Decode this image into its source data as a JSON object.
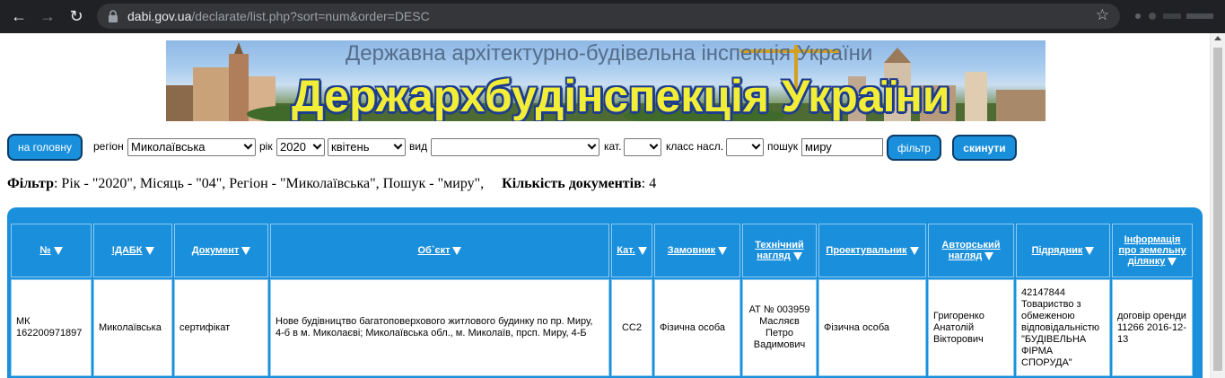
{
  "browser": {
    "url_host": "dabi.gov.ua",
    "url_path": "/declarate/list.php?sort=num&order=DESC"
  },
  "banner": {
    "subtitle": "Державна архітектурно-будівельна інспекція України",
    "title": "Держархбудінспекція України"
  },
  "filters": {
    "home_button": "на головну",
    "region_label": "регіон",
    "region_value": "Миколаївська",
    "year_label": "рік",
    "year_value": "2020",
    "month_value": "квітень",
    "type_label": "вид",
    "type_value": "",
    "cat_label": "кат.",
    "cat_value": "",
    "class_label": "класс насл.",
    "class_value": "",
    "search_label": "пошук",
    "search_value": "миру",
    "filter_button": "фільтр",
    "reset_button": "скинути"
  },
  "summary": {
    "filter_label": "Фільтр",
    "filter_text": ": Рік - \"2020\", Місяць - \"04\", Регіон - \"Миколаївська\", Пошук - \"миру\",",
    "count_label": "Кількість документів",
    "count_value": ": 4"
  },
  "table": {
    "headers": [
      "№",
      "!ДАБК",
      "Документ",
      "Об`єкт",
      "Кат.",
      "Замовник",
      "Технічний нагляд",
      "Проектувальник",
      "Авторський нагляд",
      "Підрядник",
      "Інформація про земельну ділянку"
    ],
    "rows": [
      {
        "num": "МК 162200971897",
        "dabk": "Миколаївська",
        "doc": "сертифікат",
        "object": "Нове будівництво багатоповерхового житлового будинку по пр. Миру, 4-б в м. Миколаєві; Миколаївська обл., м. Миколаїв, прсп. Миру, 4-Б",
        "cat": "СС2",
        "customer": "Фізична особа",
        "tech_supervision": "АТ № 003959 Масляєв Петро Вадимович",
        "designer": "Фізична особа",
        "author_supervision": "Григоренко Анатолій Вікторович",
        "contractor": "42147844 Товариство з обмеженою відповідальністю \"БУДІВЕЛЬНА ФІРМА СПОРУДА\"",
        "land_info": "договір оренди 11266 2016-12-13"
      }
    ]
  },
  "colors": {
    "accent": "#1a8fdb",
    "button_border": "#0b3b66",
    "banner_title": "#f2ee38"
  }
}
